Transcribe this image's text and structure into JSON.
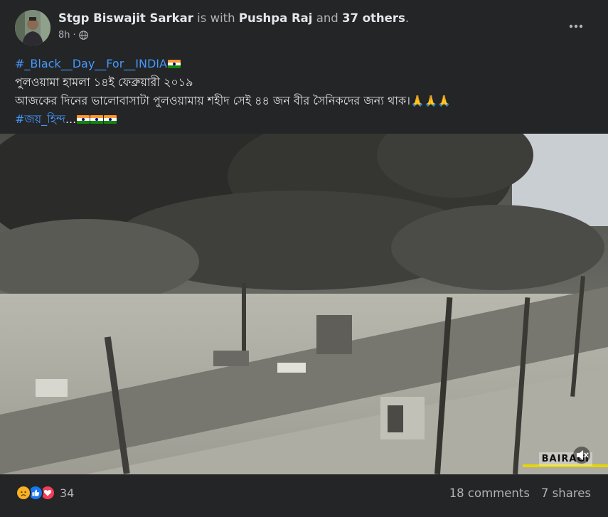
{
  "post": {
    "author": "Stgp Biswajit Sarkar",
    "with_text": "is with",
    "tagged_person": "Pushpa Raj",
    "and_text": "and",
    "others": "37 others",
    "end_punct": ".",
    "time": "8h",
    "privacy_icon": "globe-icon",
    "more_icon": "more-horizontal-icon"
  },
  "body": {
    "hashtag1": "#_Black__Day__For__INDIA",
    "line2": "পুলওয়ামা হামলা ১৪ই ফেব্রুয়ারী ২০১৯",
    "line3": "আজকের দিনের ভালোবাসাটা পুলওয়ামায় শহীদ সেই ৪৪ জন বীর সৈনিকদের জন্য থাক।",
    "hashtag2": "#জয়_হিন্দ",
    "ellipsis": "..."
  },
  "media": {
    "type": "video",
    "watermark": "BAIRAGI",
    "mute_icon": "speaker-muted-icon"
  },
  "footer": {
    "reaction_icons": [
      "sad-icon",
      "like-icon",
      "love-icon"
    ],
    "reaction_count": "34",
    "comments": "18 comments",
    "shares": "7 shares"
  },
  "colors": {
    "background": "#242526",
    "text": "#e4e6eb",
    "muted": "#b0b3b8",
    "link": "#4599ff"
  }
}
